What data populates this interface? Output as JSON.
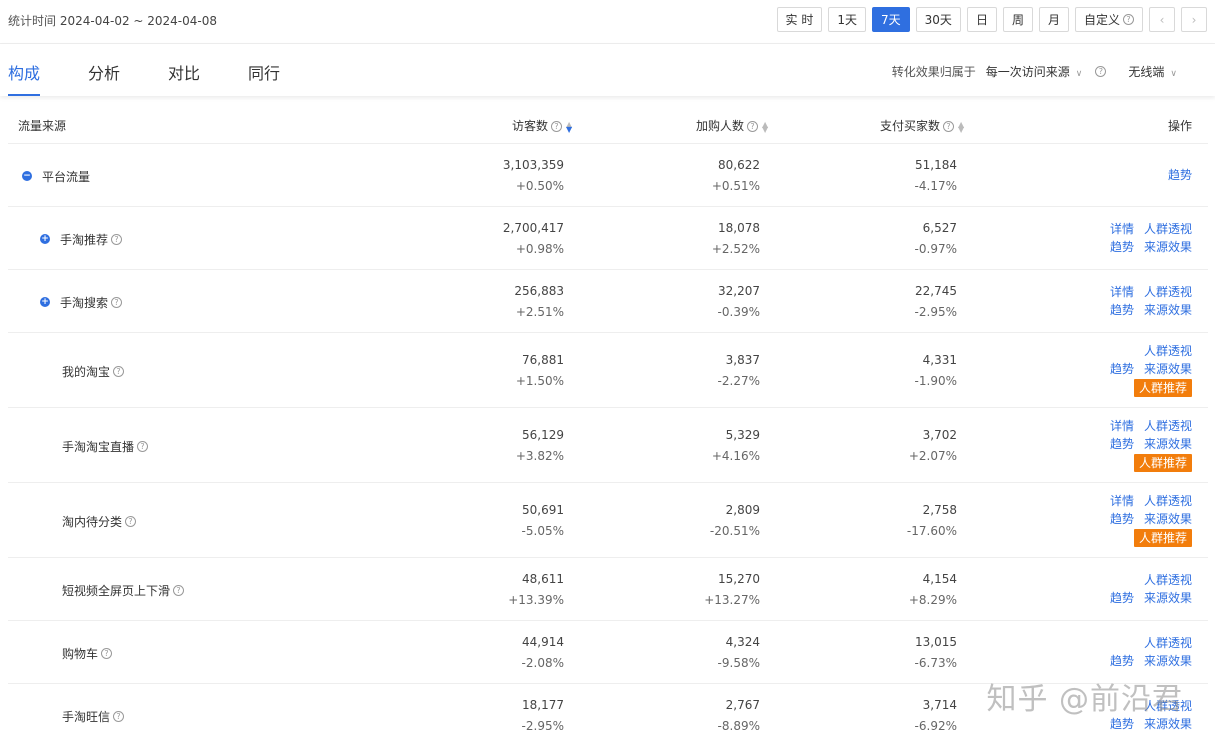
{
  "header": {
    "period_label": "统计时间",
    "period_range": "2024-04-02 ~ 2024-04-08",
    "ranges": [
      "实 时",
      "1天",
      "7天",
      "30天",
      "日",
      "周",
      "月",
      "自定义"
    ],
    "active_range": "7天",
    "prev": "‹",
    "next": "›"
  },
  "tabs": [
    "构成",
    "分析",
    "对比",
    "同行"
  ],
  "active_tab": "构成",
  "attribution": {
    "label": "转化效果归属于",
    "value": "每一次访问来源",
    "device": "无线端"
  },
  "columns": {
    "source": "流量来源",
    "visitors": "访客数",
    "cart": "加购人数",
    "buyers": "支付买家数",
    "ops": "操作"
  },
  "rows": [
    {
      "name": "平台流量",
      "level": 0,
      "toggle": "−",
      "help": false,
      "visitors": "3,103,359",
      "visitors_chg": "+0.50%",
      "cart": "80,622",
      "cart_chg": "+0.51%",
      "buyers": "51,184",
      "buyers_chg": "-4.17%",
      "ops": [
        [
          "趋势"
        ]
      ],
      "badge": ""
    },
    {
      "name": "手淘推荐",
      "level": 1,
      "toggle": "+",
      "help": true,
      "visitors": "2,700,417",
      "visitors_chg": "+0.98%",
      "cart": "18,078",
      "cart_chg": "+2.52%",
      "buyers": "6,527",
      "buyers_chg": "-0.97%",
      "ops": [
        [
          "详情",
          "人群透视"
        ],
        [
          "趋势",
          "来源效果"
        ]
      ],
      "badge": ""
    },
    {
      "name": "手淘搜索",
      "level": 1,
      "toggle": "+",
      "help": true,
      "visitors": "256,883",
      "visitors_chg": "+2.51%",
      "cart": "32,207",
      "cart_chg": "-0.39%",
      "buyers": "22,745",
      "buyers_chg": "-2.95%",
      "ops": [
        [
          "详情",
          "人群透视"
        ],
        [
          "趋势",
          "来源效果"
        ]
      ],
      "badge": ""
    },
    {
      "name": "我的淘宝",
      "level": 2,
      "toggle": "",
      "help": true,
      "visitors": "76,881",
      "visitors_chg": "+1.50%",
      "cart": "3,837",
      "cart_chg": "-2.27%",
      "buyers": "4,331",
      "buyers_chg": "-1.90%",
      "ops": [
        [
          "人群透视"
        ],
        [
          "趋势",
          "来源效果"
        ]
      ],
      "badge": "人群推荐"
    },
    {
      "name": "手淘淘宝直播",
      "level": 2,
      "toggle": "",
      "help": true,
      "visitors": "56,129",
      "visitors_chg": "+3.82%",
      "cart": "5,329",
      "cart_chg": "+4.16%",
      "buyers": "3,702",
      "buyers_chg": "+2.07%",
      "ops": [
        [
          "详情",
          "人群透视"
        ],
        [
          "趋势",
          "来源效果"
        ]
      ],
      "badge": "人群推荐"
    },
    {
      "name": "淘内待分类",
      "level": 2,
      "toggle": "",
      "help": true,
      "visitors": "50,691",
      "visitors_chg": "-5.05%",
      "cart": "2,809",
      "cart_chg": "-20.51%",
      "buyers": "2,758",
      "buyers_chg": "-17.60%",
      "ops": [
        [
          "详情",
          "人群透视"
        ],
        [
          "趋势",
          "来源效果"
        ]
      ],
      "badge": "人群推荐"
    },
    {
      "name": "短视频全屏页上下滑",
      "level": 2,
      "toggle": "",
      "help": true,
      "visitors": "48,611",
      "visitors_chg": "+13.39%",
      "cart": "15,270",
      "cart_chg": "+13.27%",
      "buyers": "4,154",
      "buyers_chg": "+8.29%",
      "ops": [
        [
          "人群透视"
        ],
        [
          "趋势",
          "来源效果"
        ]
      ],
      "badge": ""
    },
    {
      "name": "购物车",
      "level": 2,
      "toggle": "",
      "help": true,
      "visitors": "44,914",
      "visitors_chg": "-2.08%",
      "cart": "4,324",
      "cart_chg": "-9.58%",
      "buyers": "13,015",
      "buyers_chg": "-6.73%",
      "ops": [
        [
          "人群透视"
        ],
        [
          "趋势",
          "来源效果"
        ]
      ],
      "badge": ""
    },
    {
      "name": "手淘旺信",
      "level": 2,
      "toggle": "",
      "help": true,
      "visitors": "18,177",
      "visitors_chg": "-2.95%",
      "cart": "2,767",
      "cart_chg": "-8.89%",
      "buyers": "3,714",
      "buyers_chg": "-6.92%",
      "ops": [
        [
          "人群透视"
        ],
        [
          "趋势",
          "来源效果"
        ]
      ],
      "badge": ""
    }
  ],
  "watermark": "知乎 @前沿君",
  "colors": {
    "accent": "#2f6fe0",
    "badge": "#f27d0c"
  }
}
